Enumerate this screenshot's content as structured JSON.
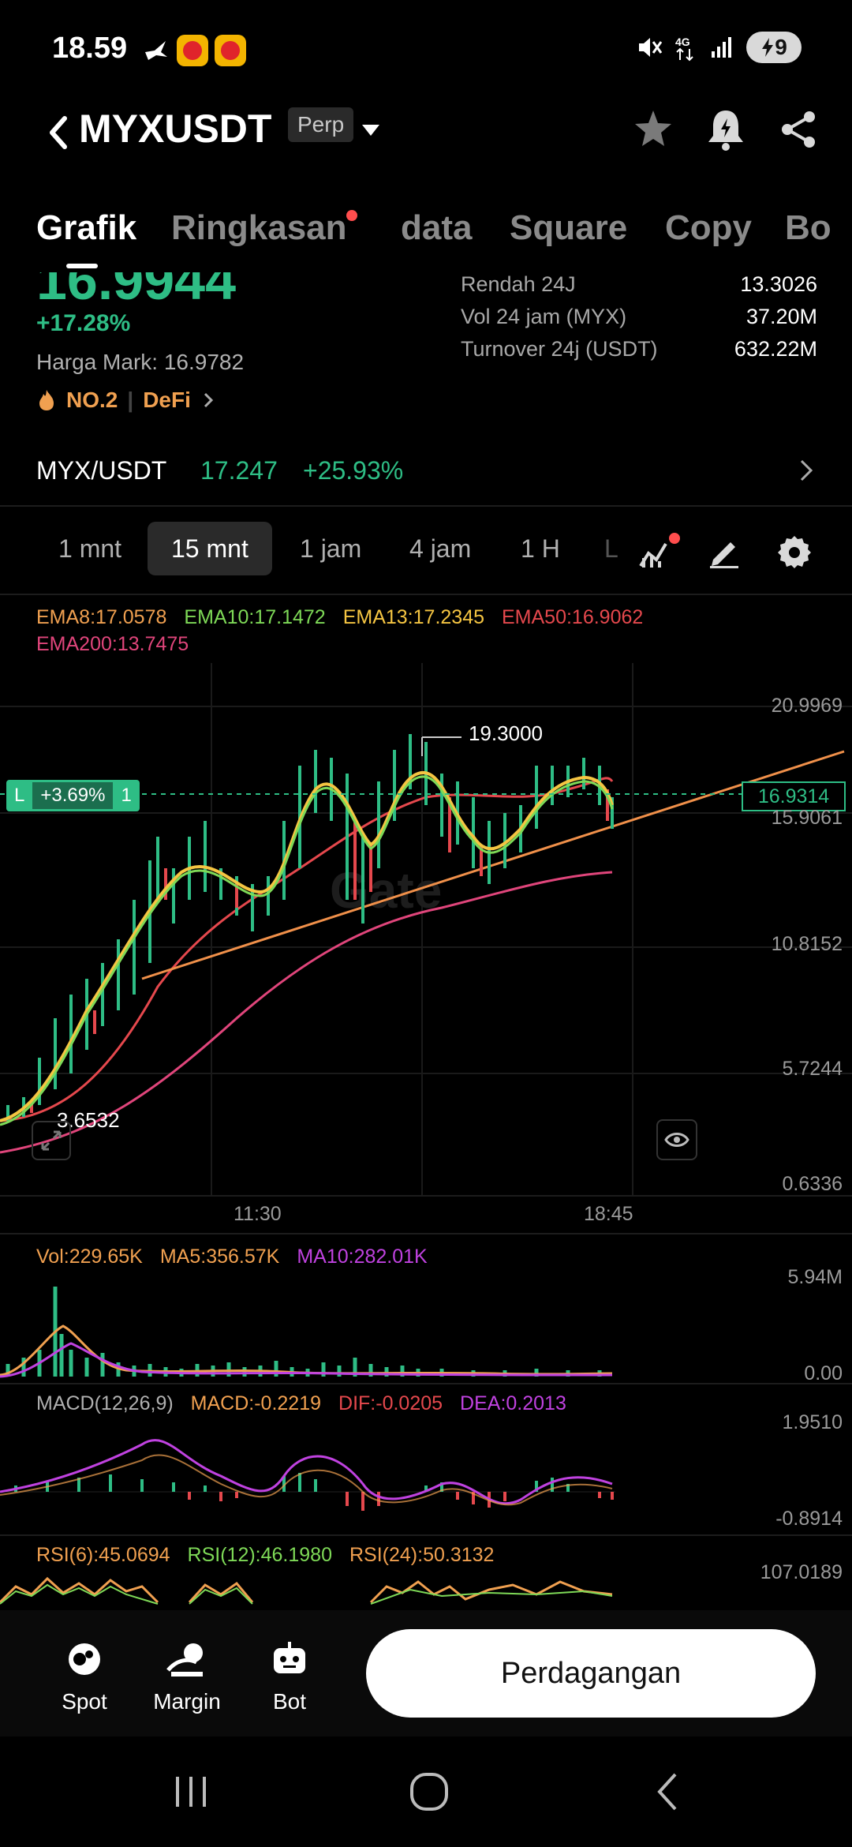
{
  "status_bar": {
    "time": "18.59",
    "battery": "9",
    "network": "4G"
  },
  "header": {
    "pair": "MYXUSDT",
    "contract_type": "Perp"
  },
  "tabs": [
    {
      "label": "Grafik",
      "active": true
    },
    {
      "label": "Ringkasan",
      "active": false,
      "badge": true
    },
    {
      "label": "data",
      "active": false
    },
    {
      "label": "Square",
      "active": false
    },
    {
      "label": "Copy",
      "active": false
    },
    {
      "label": "Bo",
      "active": false
    }
  ],
  "price": {
    "last_price_partial": "16.9944",
    "change_pct": "+17.28%",
    "mark_label": "Harga Mark:",
    "mark_value": "16.9782",
    "rank": "NO.2",
    "category": "DeFi"
  },
  "stats": [
    {
      "label": "Rendah 24J",
      "value": "13.3026"
    },
    {
      "label": "Vol 24 jam (MYX)",
      "value": "37.20M"
    },
    {
      "label": "Turnover 24j (USDT)",
      "value": "632.22M"
    }
  ],
  "spot": {
    "pair": "MYX/USDT",
    "price": "17.247",
    "change": "+25.93%"
  },
  "intervals": [
    {
      "label": "1 mnt",
      "active": false
    },
    {
      "label": "15 mnt",
      "active": true
    },
    {
      "label": "1 jam",
      "active": false
    },
    {
      "label": "4 jam",
      "active": false
    },
    {
      "label": "1 H",
      "active": false
    },
    {
      "label": "L",
      "active": false
    }
  ],
  "ema_legend": [
    {
      "label": "EMA8:17.0578",
      "color": "#f0a050"
    },
    {
      "label": "EMA10:17.1472",
      "color": "#7ed957"
    },
    {
      "label": "EMA13:17.2345",
      "color": "#f5c542"
    },
    {
      "label": "EMA50:16.9062",
      "color": "#e5484d"
    },
    {
      "label": "EMA200:13.7475",
      "color": "#e0457b"
    }
  ],
  "price_axis": [
    "20.9969",
    "15.9061",
    "10.8152",
    "5.7244",
    "0.6336"
  ],
  "time_axis": [
    "11:30",
    "18:45"
  ],
  "annotations": {
    "high": "19.3000",
    "low": "3.6532",
    "current": "16.9314",
    "position_side": "L",
    "position_pnl": "+3.69%",
    "position_qty": "1"
  },
  "volume_legend": [
    {
      "label": "Vol:229.65K",
      "color": "#f0a050"
    },
    {
      "label": "MA5:356.57K",
      "color": "#f0a050"
    },
    {
      "label": "MA10:282.01K",
      "color": "#c042e0"
    }
  ],
  "volume_axis": [
    "5.94M",
    "0.00"
  ],
  "macd_legend": [
    {
      "label": "MACD(12,26,9)",
      "color": "#b0b0b0"
    },
    {
      "label": "MACD:-0.2219",
      "color": "#f0a050"
    },
    {
      "label": "DIF:-0.0205",
      "color": "#e5484d"
    },
    {
      "label": "DEA:0.2013",
      "color": "#c042e0"
    }
  ],
  "macd_axis": [
    "1.9510",
    "-0.8914"
  ],
  "rsi_legend": [
    {
      "label": "RSI(6):45.0694",
      "color": "#f0a050"
    },
    {
      "label": "RSI(12):46.1980",
      "color": "#7ed957"
    },
    {
      "label": "RSI(24):50.3132",
      "color": "#f0a050"
    }
  ],
  "rsi_axis": [
    "107.0189"
  ],
  "bottom_nav": [
    {
      "label": "Spot",
      "icon": "spot-icon"
    },
    {
      "label": "Margin",
      "icon": "margin-icon"
    },
    {
      "label": "Bot",
      "icon": "bot-icon"
    }
  ],
  "trade_button": "Perdagangan",
  "colors": {
    "up": "#2ebd85",
    "down": "#e5484d",
    "accent": "#f0a050"
  }
}
